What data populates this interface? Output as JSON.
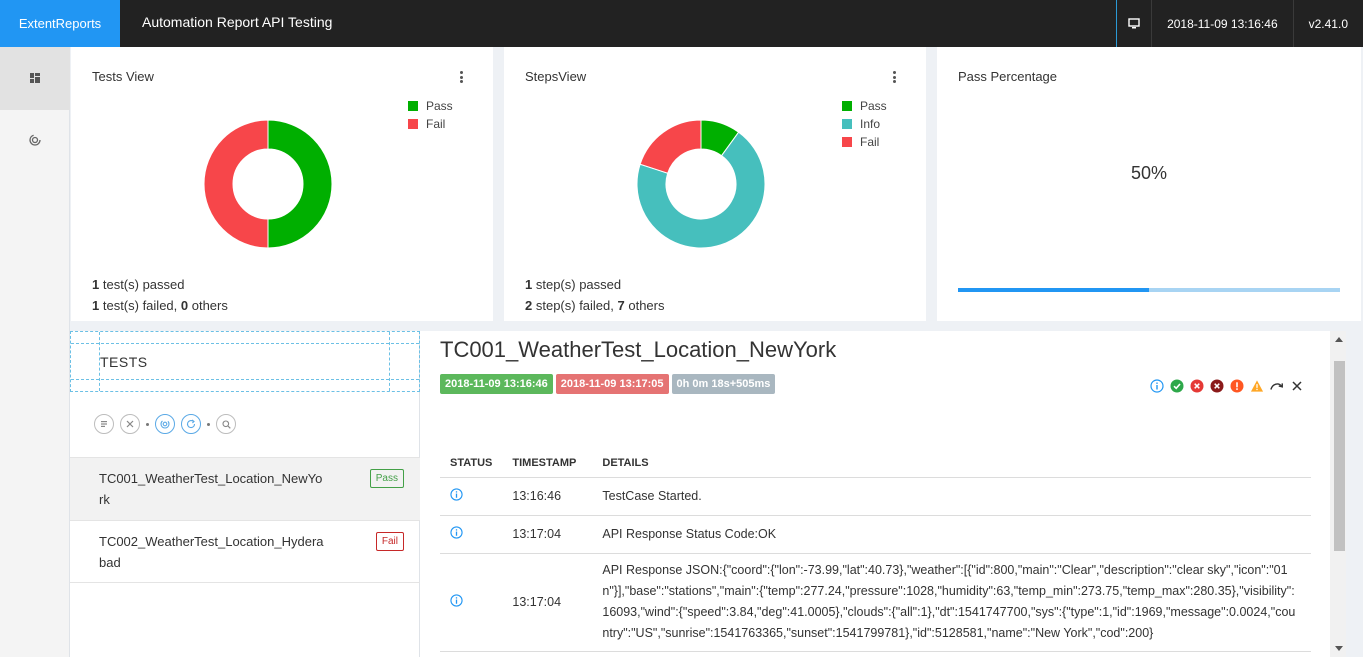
{
  "brand": "ExtentReports",
  "report_name": "Automation Report API Testing",
  "nav": {
    "timestamp": "2018-11-09 13:16:46",
    "version": "v2.41.0"
  },
  "sidebar": {
    "items": [
      {
        "icon": "dashboard-icon"
      },
      {
        "icon": "spinner-icon"
      }
    ]
  },
  "colors": {
    "pass": "#00af00",
    "fail": "#f7464a",
    "info": "#46bfbd",
    "accent": "#2196f3"
  },
  "tests_view": {
    "title": "Tests View",
    "legend": [
      "Pass",
      "Fail"
    ],
    "passed_count": "1",
    "passed_text": " test(s) passed",
    "failed_count": "1",
    "failed_text": " test(s) failed, ",
    "others_count": "0",
    "others_text": " others"
  },
  "steps_view": {
    "title": "StepsView",
    "legend": [
      "Pass",
      "Info",
      "Fail"
    ],
    "passed_count": "1",
    "passed_text": " step(s) passed",
    "failed_count": "2",
    "failed_text": " step(s) failed, ",
    "others_count": "7",
    "others_text": " others"
  },
  "pass_percentage": {
    "title": "Pass Percentage",
    "value": "50%",
    "fraction": 0.5
  },
  "chart_data": [
    {
      "type": "pie",
      "title": "Tests View",
      "categories": [
        "Pass",
        "Fail"
      ],
      "values": [
        1,
        1
      ]
    },
    {
      "type": "pie",
      "title": "StepsView",
      "categories": [
        "Pass",
        "Info",
        "Fail"
      ],
      "values": [
        1,
        7,
        2
      ]
    }
  ],
  "tests_panel": {
    "header": "TESTS",
    "tests": [
      {
        "name": "TC001_WeatherTest_Location_NewYork",
        "status": "Pass"
      },
      {
        "name": "TC002_WeatherTest_Location_Hyderabad",
        "status": "Fail"
      }
    ]
  },
  "detail": {
    "title": "TC001_WeatherTest_Location_NewYork",
    "start_time": "2018-11-09 13:16:46",
    "end_time": "2018-11-09 13:17:05",
    "duration": "0h 0m 18s+505ms",
    "columns": [
      "STATUS",
      "TIMESTAMP",
      "DETAILS"
    ],
    "logs": [
      {
        "status": "info",
        "timestamp": "13:16:46",
        "details": "TestCase Started."
      },
      {
        "status": "info",
        "timestamp": "13:17:04",
        "details": "API Response Status Code:OK"
      },
      {
        "status": "info",
        "timestamp": "13:17:04",
        "details": "API Response JSON:{\"coord\":{\"lon\":-73.99,\"lat\":40.73},\"weather\":[{\"id\":800,\"main\":\"Clear\",\"description\":\"clear sky\",\"icon\":\"01n\"}],\"base\":\"stations\",\"main\":{\"temp\":277.24,\"pressure\":1028,\"humidity\":63,\"temp_min\":273.75,\"temp_max\":280.35},\"visibility\":16093,\"wind\":{\"speed\":3.84,\"deg\":41.0005},\"clouds\":{\"all\":1},\"dt\":1541747700,\"sys\":{\"type\":1,\"id\":1969,\"message\":0.0024,\"country\":\"US\",\"sunrise\":1541763365,\"sunset\":1541799781},\"id\":5128581,\"name\":\"New York\",\"cod\":200}"
      }
    ]
  }
}
